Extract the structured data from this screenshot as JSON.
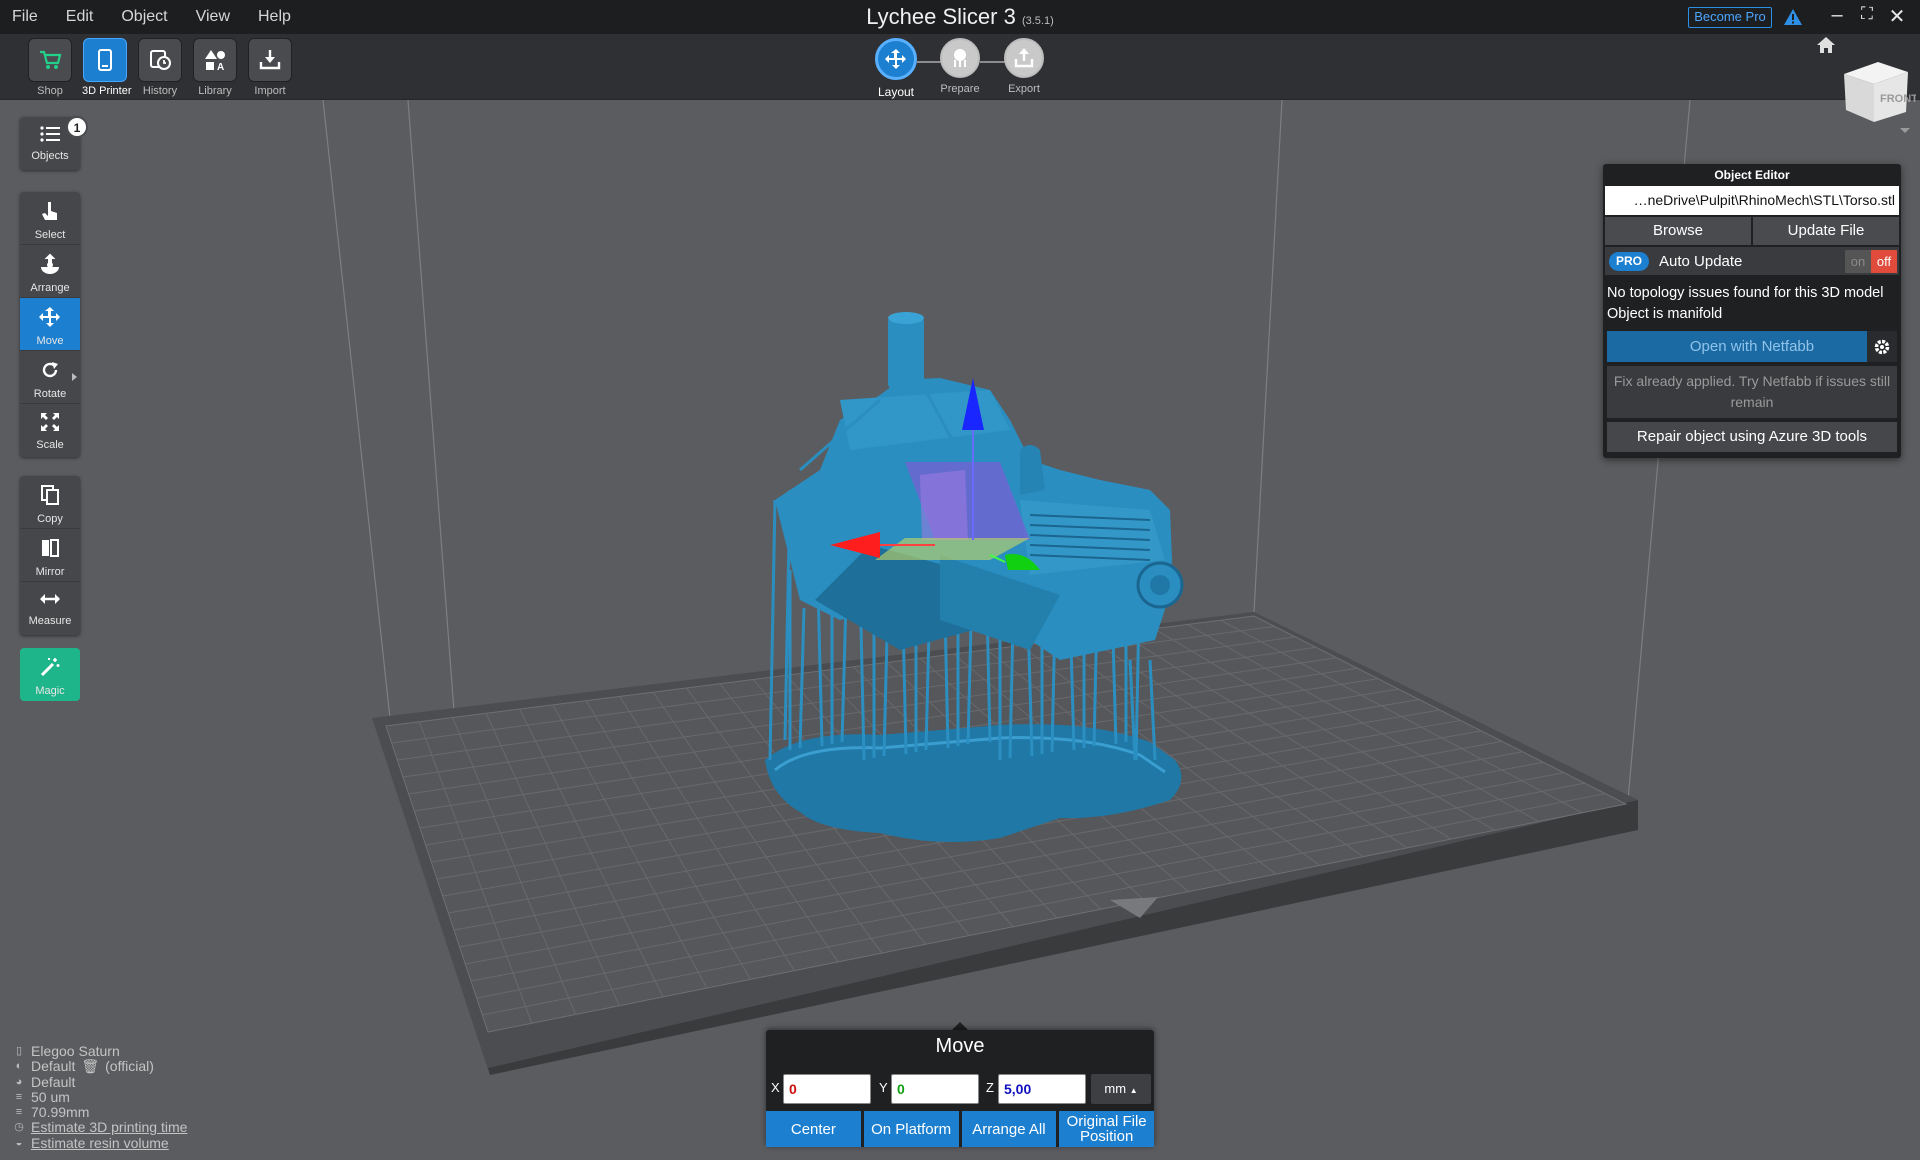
{
  "menu": [
    "File",
    "Edit",
    "Object",
    "View",
    "Help"
  ],
  "app": {
    "title": "Lychee Slicer 3",
    "version": "(3.5.1)",
    "become_pro": "Become Pro"
  },
  "toolbar": [
    {
      "label": "Shop",
      "icon": "cart-icon"
    },
    {
      "label": "3D Printer",
      "icon": "printer-icon"
    },
    {
      "label": "History",
      "icon": "history-icon"
    },
    {
      "label": "Library",
      "icon": "library-icon"
    },
    {
      "label": "Import",
      "icon": "import-icon"
    }
  ],
  "workflow": [
    {
      "label": "Layout",
      "icon": "move-icon"
    },
    {
      "label": "Prepare",
      "icon": "supports-icon"
    },
    {
      "label": "Export",
      "icon": "export-icon"
    }
  ],
  "viewcube": {
    "face": "FRONT"
  },
  "sidebar": {
    "objects": {
      "label": "Objects",
      "count": "1"
    },
    "tools1": [
      {
        "label": "Select",
        "icon": "select-icon"
      },
      {
        "label": "Arrange",
        "icon": "arrange-icon"
      },
      {
        "label": "Move",
        "icon": "move-icon"
      },
      {
        "label": "Rotate",
        "icon": "rotate-icon"
      },
      {
        "label": "Scale",
        "icon": "scale-icon"
      }
    ],
    "tools2": [
      {
        "label": "Copy",
        "icon": "copy-icon"
      },
      {
        "label": "Mirror",
        "icon": "mirror-icon"
      },
      {
        "label": "Measure",
        "icon": "measure-icon"
      }
    ],
    "magic": {
      "label": "Magic",
      "icon": "magic-wand-icon"
    }
  },
  "object_editor": {
    "title": "Object Editor",
    "path": "…neDrive\\Pulpit\\RhinoMech\\STL\\Torso.stl",
    "browse": "Browse",
    "update_file": "Update File",
    "pro_badge": "PRO",
    "auto_update": "Auto Update",
    "toggle_on": "on",
    "toggle_off": "off",
    "topology_line1": "No topology issues found for this 3D model",
    "topology_line2": "Object is manifold",
    "open_netfabb": "Open with Netfabb",
    "fix_info": "Fix already applied. Try Netfabb if issues still remain",
    "repair_azure": "Repair object using Azure 3D tools"
  },
  "move_panel": {
    "title": "Move",
    "x_label": "X",
    "x_value": "0",
    "y_label": "Y",
    "y_value": "0",
    "z_label": "Z",
    "z_value": "5,00",
    "unit": "mm",
    "buttons": [
      "Center",
      "On Platform",
      "Arrange All",
      "Original File Position"
    ]
  },
  "printer_info": {
    "printer": "Elegoo Saturn",
    "resin": "Default",
    "resin_tag": "(official)",
    "profile": "Default",
    "layer": "50 um",
    "height": "70.99mm",
    "estimate_time": "Estimate 3D printing time",
    "estimate_volume": "Estimate resin volume"
  },
  "colors": {
    "accent": "#1c7fd0",
    "model": "#2a8fc0",
    "magic": "#1fb58a",
    "toggle_off": "#e14b3b",
    "gizmo_x": "#ff2020",
    "gizmo_y": "#20d020",
    "gizmo_z": "#2020ff"
  }
}
